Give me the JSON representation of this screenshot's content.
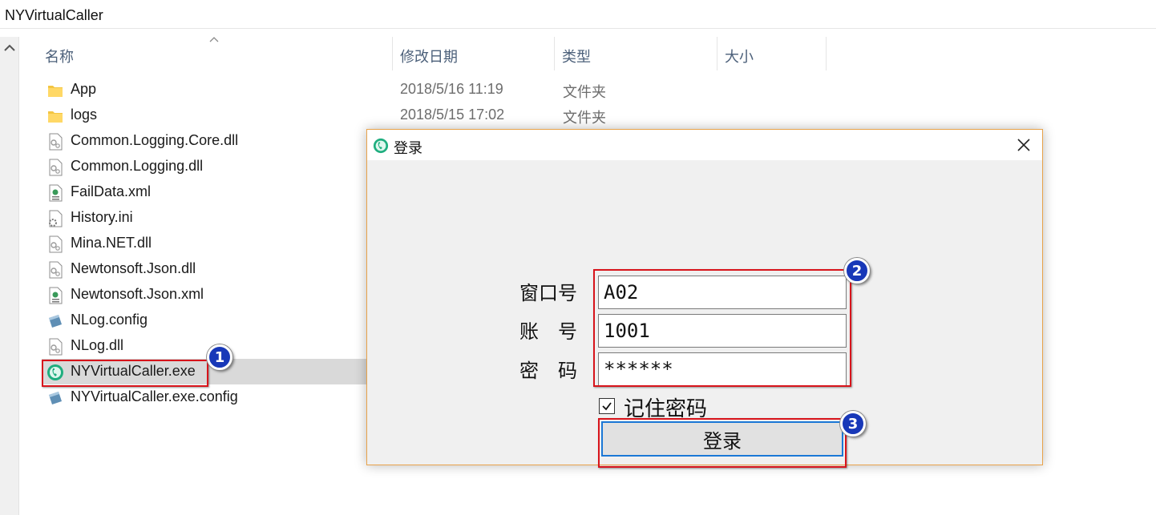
{
  "window": {
    "title": "NYVirtualCaller"
  },
  "columns": {
    "name": "名称",
    "date": "修改日期",
    "type": "类型",
    "size": "大小"
  },
  "files": [
    {
      "name": "App",
      "date": "2018/5/16 11:19",
      "type": "文件夹",
      "icon": "folder-icon"
    },
    {
      "name": "logs",
      "date": "2018/5/15 17:02",
      "type": "文件夹",
      "icon": "folder-icon"
    },
    {
      "name": "Common.Logging.Core.dll",
      "icon": "dll-file-icon"
    },
    {
      "name": "Common.Logging.dll",
      "icon": "dll-file-icon"
    },
    {
      "name": "FailData.xml",
      "icon": "xml-file-icon"
    },
    {
      "name": "History.ini",
      "icon": "ini-file-icon"
    },
    {
      "name": "Mina.NET.dll",
      "icon": "dll-file-icon"
    },
    {
      "name": "Newtonsoft.Json.dll",
      "icon": "dll-file-icon"
    },
    {
      "name": "Newtonsoft.Json.xml",
      "icon": "xml-file-icon"
    },
    {
      "name": "NLog.config",
      "icon": "config-file-icon"
    },
    {
      "name": "NLog.dll",
      "icon": "dll-file-icon"
    },
    {
      "name": "NYVirtualCaller.exe",
      "icon": "app-exe-icon",
      "selected": true
    },
    {
      "name": "NYVirtualCaller.exe.config",
      "icon": "config-file-icon"
    }
  ],
  "dialog": {
    "title": "登录",
    "window_label": "窗口号",
    "window_value": "A02",
    "account_label": "账　号",
    "account_value": "1001",
    "password_label": "密　码",
    "password_value": "******",
    "remember_label": "记住密码",
    "remember_checked": true,
    "login_label": "登录"
  },
  "steps": [
    "1",
    "2",
    "3"
  ],
  "colors": {
    "annotation_red": "#d8141b",
    "badge_blue": "#1838b8",
    "button_focus": "#1b78d6",
    "dialog_border": "#e8a24a",
    "selected_row": "#d9d9d9"
  }
}
